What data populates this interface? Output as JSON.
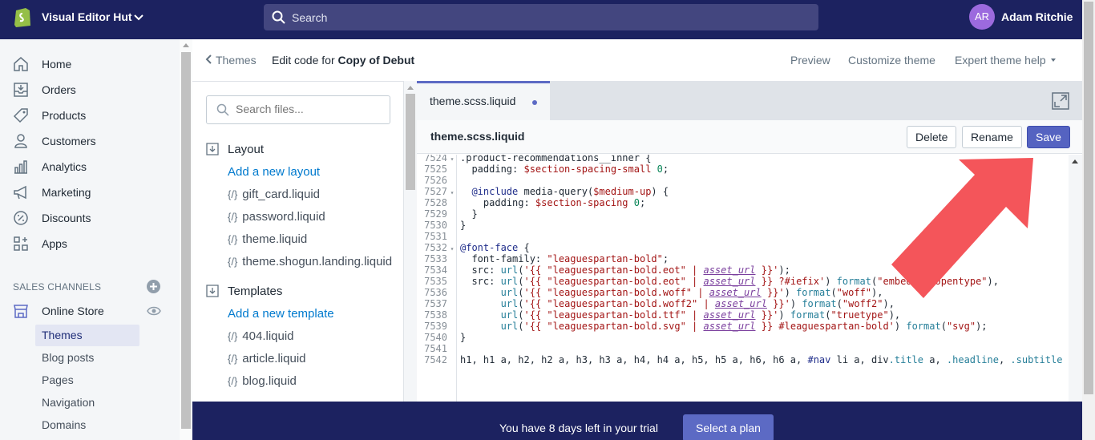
{
  "topbar": {
    "store_name": "Visual Editor Hut",
    "search_placeholder": "Search",
    "avatar_initials": "AR",
    "user_name": "Adam Ritchie"
  },
  "nav": {
    "items": [
      {
        "label": "Home",
        "icon": "home-icon"
      },
      {
        "label": "Orders",
        "icon": "orders-icon"
      },
      {
        "label": "Products",
        "icon": "products-icon"
      },
      {
        "label": "Customers",
        "icon": "customers-icon"
      },
      {
        "label": "Analytics",
        "icon": "analytics-icon"
      },
      {
        "label": "Marketing",
        "icon": "marketing-icon"
      },
      {
        "label": "Discounts",
        "icon": "discounts-icon"
      },
      {
        "label": "Apps",
        "icon": "apps-icon"
      }
    ],
    "sales_channels_heading": "SALES CHANNELS",
    "online_store": "Online Store",
    "sub_items": [
      "Themes",
      "Blog posts",
      "Pages",
      "Navigation",
      "Domains"
    ],
    "active_sub_item": "Themes"
  },
  "header": {
    "back_label": "Themes",
    "edit_prefix": "Edit code for",
    "theme_name": "Copy of Debut",
    "preview": "Preview",
    "customize": "Customize theme",
    "expert_help": "Expert theme help"
  },
  "files": {
    "search_placeholder": "Search files...",
    "layout_heading": "Layout",
    "add_layout": "Add a new layout",
    "layout_files": [
      "gift_card.liquid",
      "password.liquid",
      "theme.liquid",
      "theme.shogun.landing.liquid"
    ],
    "templates_heading": "Templates",
    "add_template": "Add a new template",
    "template_files": [
      "404.liquid",
      "article.liquid",
      "blog.liquid"
    ],
    "file_icon": "{/}"
  },
  "editor": {
    "tab_name": "theme.scss.liquid",
    "file_name": "theme.scss.liquid",
    "delete": "Delete",
    "rename": "Rename",
    "save": "Save",
    "line_numbers": [
      "7524",
      "7525",
      "7526",
      "7527",
      "7528",
      "7529",
      "7530",
      "7531",
      "7532",
      "7533",
      "7534",
      "7535",
      "7536",
      "7537",
      "7538",
      "7539",
      "7540",
      "7541",
      "7542"
    ]
  },
  "trial": {
    "message": "You have 8 days left in your trial",
    "button": "Select a plan"
  },
  "colors": {
    "topbar": "#1c2260",
    "accent": "#5c6ac4",
    "arrow": "#f4555a"
  }
}
